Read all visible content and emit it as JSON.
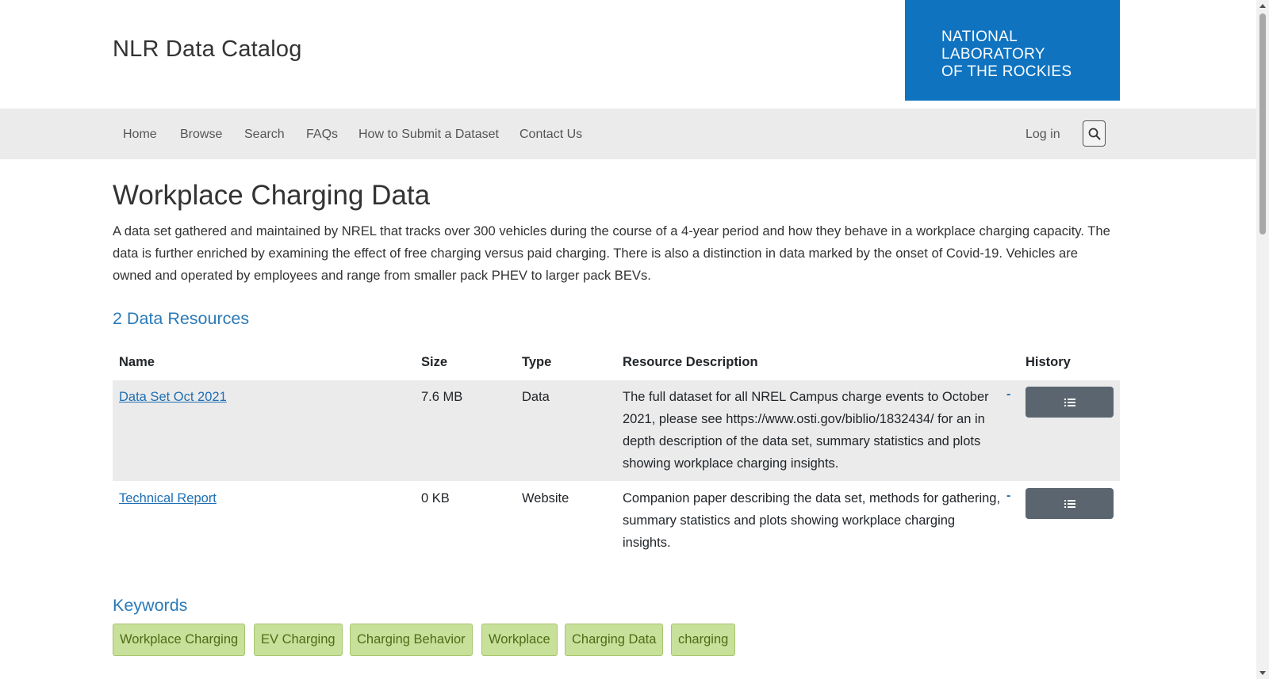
{
  "header": {
    "site_title": "NLR Data Catalog",
    "logo_lines": [
      "NATIONAL",
      "LABORATORY",
      "OF THE ROCKIES"
    ],
    "logo_color": "#0f73c0"
  },
  "nav": {
    "items": [
      "Home",
      "Browse",
      "Search",
      "FAQs",
      "How to Submit a Dataset",
      "Contact Us"
    ],
    "login": "Log in",
    "search_icon": "search-icon"
  },
  "page": {
    "title": "Workplace Charging Data",
    "description": "A data set gathered and maintained by NREL that tracks over 300 vehicles during the course of a 4-year period and how they behave in a workplace charging capacity. The data is further enriched by examining the effect of free charging versus paid charging. There is also a distinction in data marked by the onset of Covid-19. Vehicles are owned and operated by employees and range from smaller pack PHEV to larger pack BEVs."
  },
  "resources": {
    "heading": "2 Data Resources",
    "columns": [
      "Name",
      "Size",
      "Type",
      "Resource Description",
      "History"
    ],
    "rows": [
      {
        "name": "Data Set Oct 2021",
        "size": "7.6 MB",
        "type": "Data",
        "description": "The full dataset for all NREL Campus charge events to October 2021, please see https://www.osti.gov/biblio/1832434/ for an in depth description of the data set, summary statistics and plots showing workplace charging insights.",
        "extra": "-",
        "history_icon": "list-icon"
      },
      {
        "name": "Technical Report",
        "size": "0 KB",
        "type": "Website",
        "description": "Companion paper describing the data set, methods for gathering, summary statistics and plots showing workplace charging insights.",
        "extra": "-",
        "history_icon": "list-icon"
      }
    ]
  },
  "keywords": {
    "heading": "Keywords",
    "tags": [
      "Workplace Charging",
      "EV Charging",
      "Charging Behavior",
      "Workplace",
      "Charging Data",
      "charging"
    ],
    "tag_color": "#c7e09a"
  }
}
